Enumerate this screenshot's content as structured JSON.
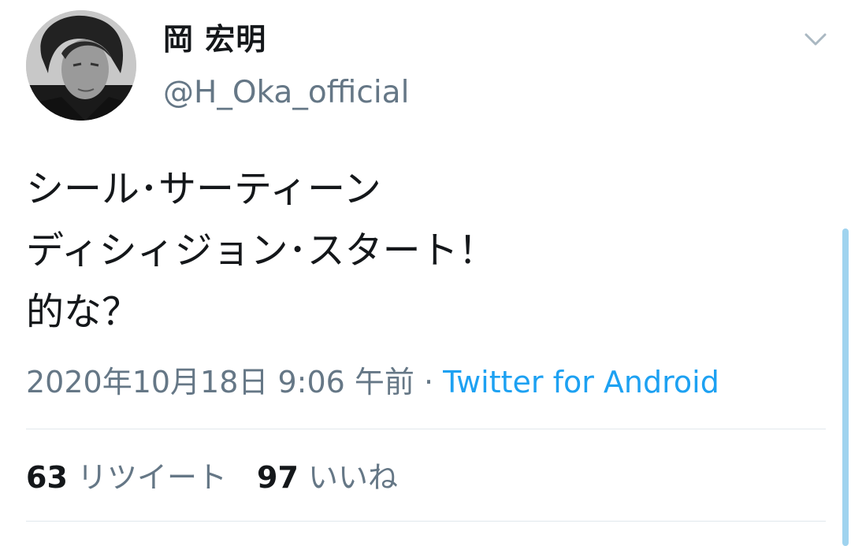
{
  "author": {
    "display_name": "岡 宏明",
    "handle": "@H_Oka_official"
  },
  "tweet": {
    "lines": [
      "シール･サーティーン",
      "ディシィジョン･スタート！",
      "的な？"
    ],
    "timestamp": "2020年10月18日 9:06 午前",
    "separator": " · ",
    "source": "Twitter for Android"
  },
  "stats": {
    "retweets_count": "63",
    "retweets_label": "リツイート",
    "likes_count": "97",
    "likes_label": "いいね"
  },
  "icons": {
    "menu": "chevron-down-icon"
  },
  "colors": {
    "text_primary": "#14171a",
    "text_secondary": "#657786",
    "link": "#1da1f2",
    "divider": "#e1e8ed"
  }
}
